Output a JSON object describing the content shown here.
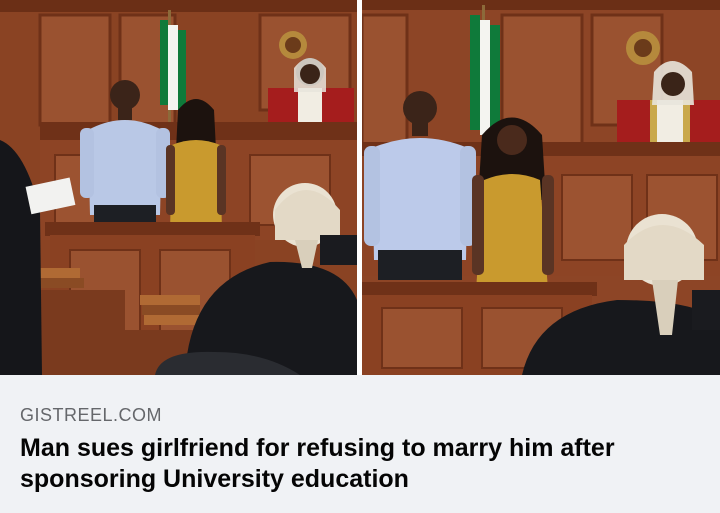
{
  "link_preview": {
    "images": [
      {
        "name": "courtroom-photo-left"
      },
      {
        "name": "courtroom-photo-right"
      }
    ],
    "source": "GISTREEL.COM",
    "headline": "Man sues girlfriend for refusing to marry him after sponsoring University education"
  }
}
